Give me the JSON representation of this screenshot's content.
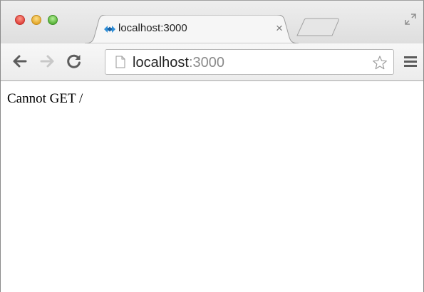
{
  "tab": {
    "title": "localhost:3000",
    "close_glyph": "×",
    "favicon": "diamond-arrow-icon"
  },
  "toolbar": {
    "back_icon": "back-arrow-icon",
    "forward_icon": "forward-arrow-icon",
    "reload_icon": "reload-icon",
    "menu_icon": "hamburger-menu-icon"
  },
  "omnibox": {
    "host": "localhost",
    "port": ":3000",
    "star_icon": "star-icon"
  },
  "page": {
    "message": "Cannot GET /"
  },
  "colors": {
    "close": "#e0443e",
    "minimize": "#e3a82c",
    "maximize": "#5ab43a",
    "favicon": "#2f8fd8"
  }
}
